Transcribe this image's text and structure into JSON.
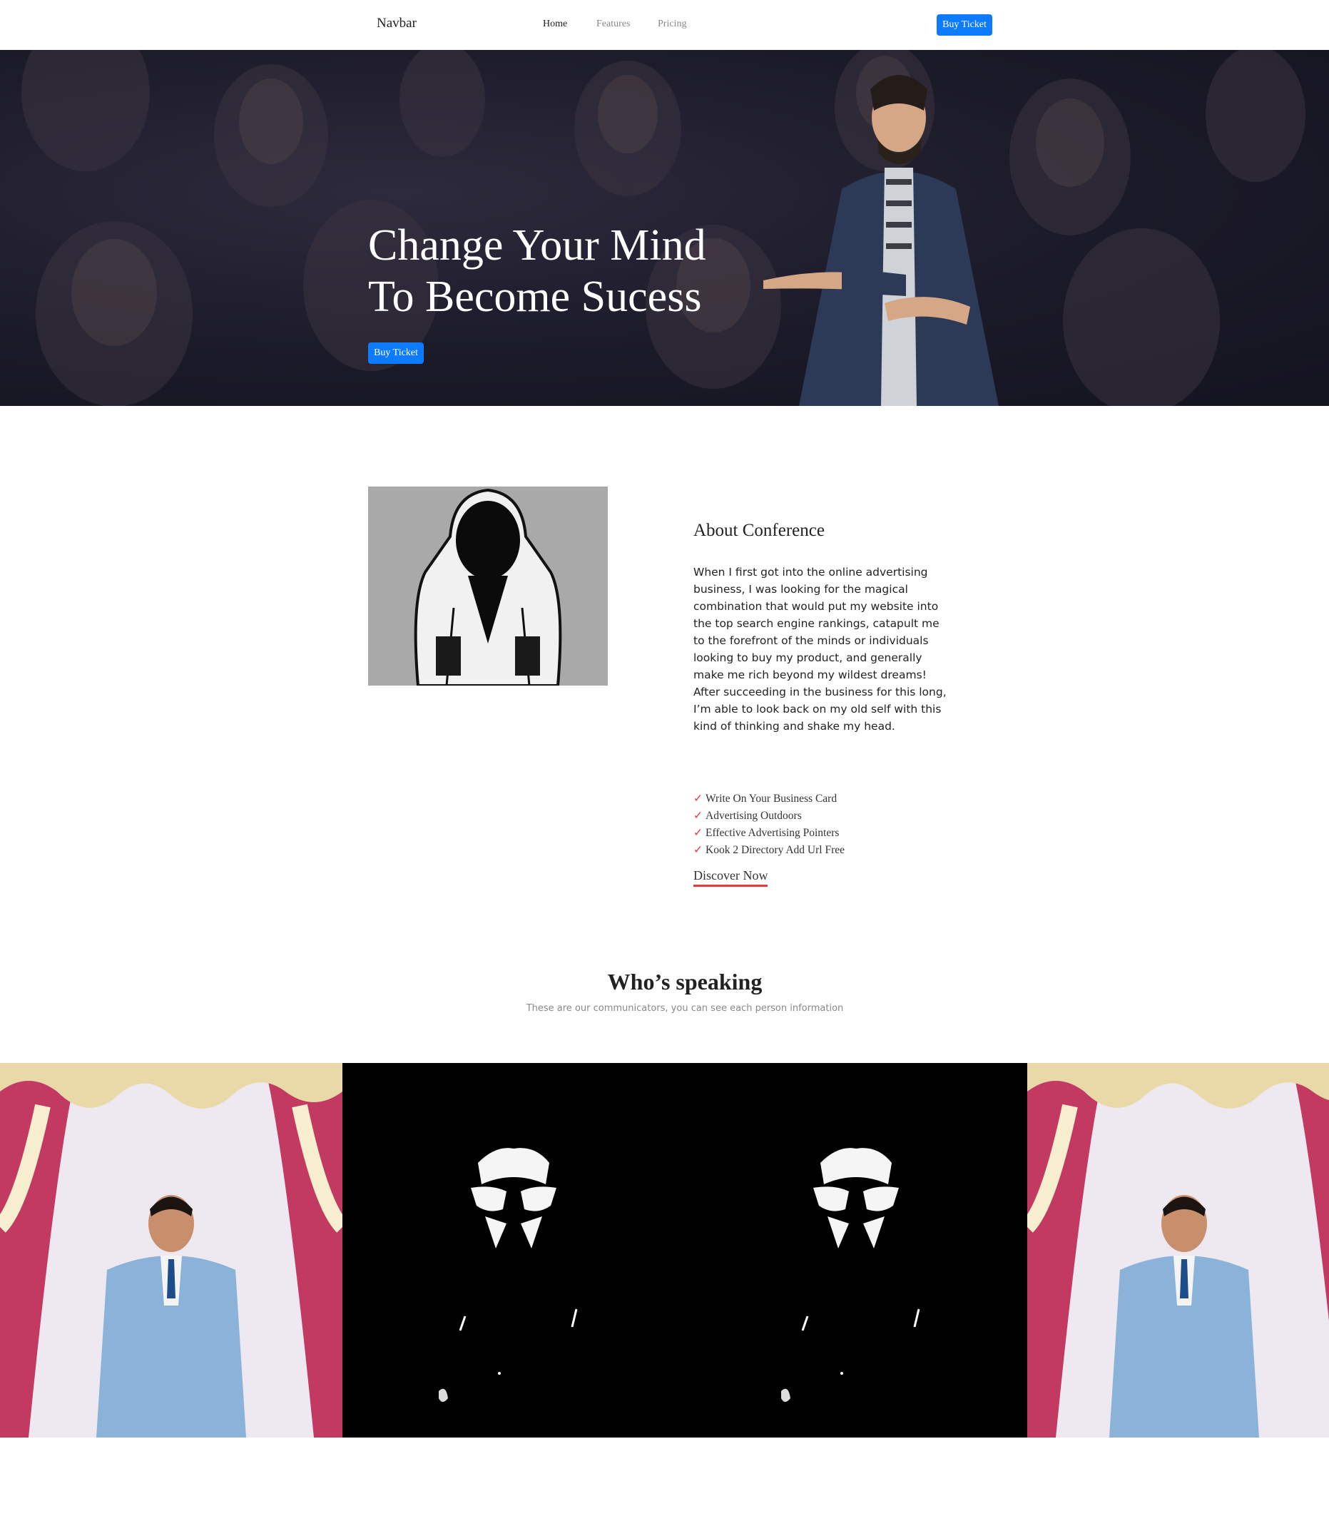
{
  "navbar": {
    "brand": "Navbar",
    "links": [
      "Home",
      "Features",
      "Pricing"
    ],
    "cta": "Buy Ticket"
  },
  "hero": {
    "title_line1": "Change Your Mind",
    "title_line2": "To Become Sucess",
    "cta": "Buy Ticket"
  },
  "about": {
    "title": "About Conference",
    "text": "When I first got into the online advertising business, I was looking for the magical combination that would put my website into the top search engine rankings, catapult me to the forefront of the minds or individuals looking to buy my product, and generally make me rich beyond my wildest dreams! After succeeding in the business for this long, I’m able to look back on my old self with this kind of thinking and shake my head.",
    "checklist": [
      "Write On Your Business Card",
      "Advertising Outdoors",
      "Effective Advertising Pointers",
      "Kook 2 Directory Add Url Free"
    ],
    "link": "Discover Now"
  },
  "speaking": {
    "title": "Who’s speaking",
    "subtitle": "These are our communicators, you can see each person information"
  },
  "colors": {
    "primary": "#0d7bff",
    "accent": "#e23c3c",
    "hero_bg": "#1b1a28"
  }
}
